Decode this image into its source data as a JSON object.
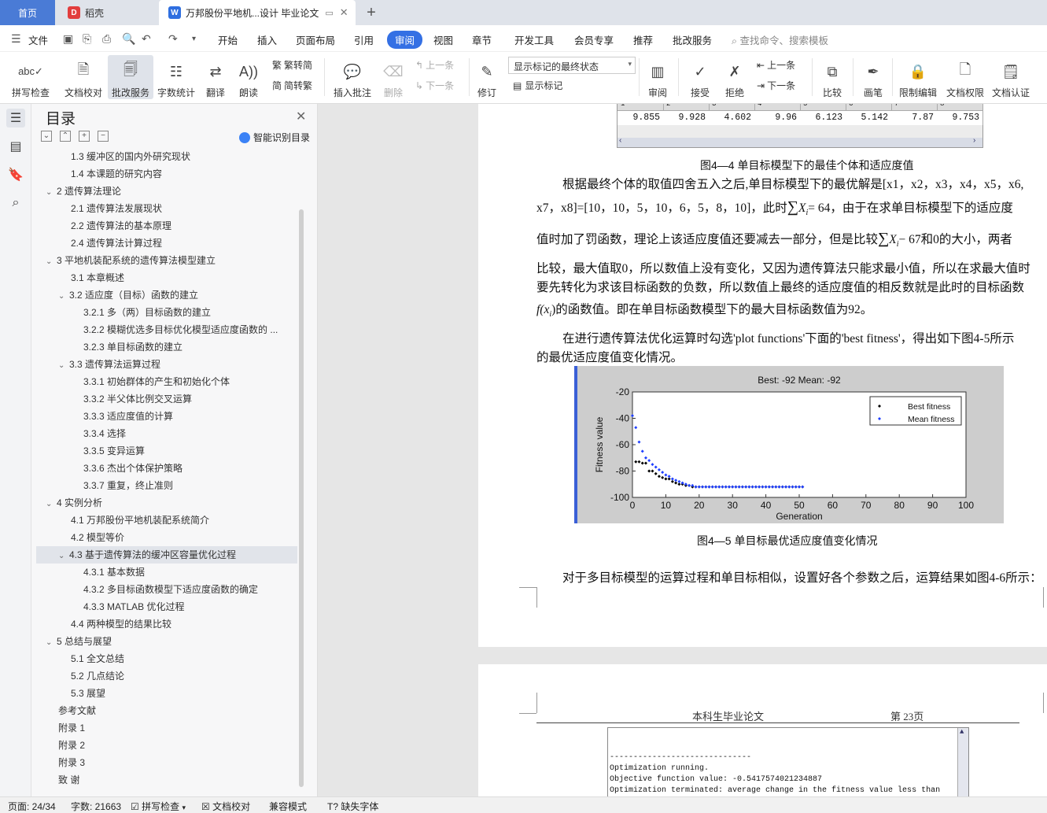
{
  "tabs": {
    "home": "首页",
    "daoke": "稻壳",
    "doc": "万邦股份平地机...设计 毕业论文",
    "plus": "+"
  },
  "menu": {
    "file": "文件",
    "items": [
      "开始",
      "插入",
      "页面布局",
      "引用",
      "审阅",
      "视图",
      "章节",
      "开发工具",
      "会员专享",
      "推荐",
      "批改服务"
    ],
    "active": "审阅",
    "search": "查找命令、搜索模板"
  },
  "ribbon": {
    "spell": "拼写检查",
    "proof": "文档校对",
    "grading": "批改服务",
    "wordcount": "字数统计",
    "translate": "翻译",
    "read": "朗读",
    "trad": "繁转简",
    "simp": "简转繁",
    "insert_comment": "插入批注",
    "delete": "删除",
    "prev": "上一条",
    "next": "下一条",
    "revise": "修订",
    "markup_state": "显示标记的最终状态",
    "show_markup": "显示标记",
    "review": "审阅",
    "accept": "接受",
    "reject": "拒绝",
    "prev2": "上一条",
    "next2": "下一条",
    "compare": "比较",
    "pen": "画笔",
    "restrict": "限制编辑",
    "perm": "文档权限",
    "cert": "文档认证"
  },
  "toc": {
    "title": "目录",
    "smart": "智能识别目录",
    "items": [
      {
        "label": "1.3  缓冲区的国内外研究现状",
        "level": 2
      },
      {
        "label": "1.4  本课题的研究内容",
        "level": 2
      },
      {
        "label": "2  遗传算法理论",
        "level": 1,
        "chev": "v"
      },
      {
        "label": "2.1  遗传算法发展现状",
        "level": 2
      },
      {
        "label": "2.2  遗传算法的基本原理",
        "level": 2
      },
      {
        "label": "2.4  遗传算法计算过程",
        "level": 2
      },
      {
        "label": "3 平地机装配系统的遗传算法模型建立",
        "level": 1,
        "chev": "v"
      },
      {
        "label": "3.1    本章概述",
        "level": 2
      },
      {
        "label": "3.2    适应度（目标）函数的建立",
        "level": 2,
        "chev": "v"
      },
      {
        "label": "3.2.1    多（两）目标函数的建立",
        "level": 3
      },
      {
        "label": "3.2.2    模糊优选多目标优化模型适应度函数的 ...",
        "level": 3
      },
      {
        "label": "3.2.3    单目标函数的建立",
        "level": 3
      },
      {
        "label": "3.3    遗传算法运算过程",
        "level": 2,
        "chev": "v"
      },
      {
        "label": "3.3.1    初始群体的产生和初始化个体",
        "level": 3
      },
      {
        "label": "3.3.2    半父体比例交叉运算",
        "level": 3
      },
      {
        "label": "3.3.3    适应度值的计算",
        "level": 3
      },
      {
        "label": "3.3.4    选择",
        "level": 3
      },
      {
        "label": "3.3.5    变异运算",
        "level": 3
      },
      {
        "label": "3.3.6    杰出个体保护策略",
        "level": 3
      },
      {
        "label": "3.3.7    重复，终止准则",
        "level": 3
      },
      {
        "label": "4  实例分析",
        "level": 1,
        "chev": "v"
      },
      {
        "label": "4.1    万邦股份平地机装配系统简介",
        "level": 2
      },
      {
        "label": "4.2    模型等价",
        "level": 2
      },
      {
        "label": "4.3    基于遗传算法的缓冲区容量优化过程",
        "level": 2,
        "chev": "v",
        "selected": true
      },
      {
        "label": "4.3.1    基本数据",
        "level": 3
      },
      {
        "label": "4.3.2    多目标函数模型下适应度函数的确定",
        "level": 3
      },
      {
        "label": "4.3.3    MATLAB 优化过程",
        "level": 3
      },
      {
        "label": "4.4    两种模型的结果比较",
        "level": 2
      },
      {
        "label": "5  总结与展望",
        "level": 1,
        "chev": "v"
      },
      {
        "label": "5.1    全文总结",
        "level": 2
      },
      {
        "label": "5.2    几点结论",
        "level": 2
      },
      {
        "label": "5.3    展望",
        "level": 2
      },
      {
        "label": "参考文献",
        "level": 0
      },
      {
        "label": "附录 1",
        "level": 0
      },
      {
        "label": "附录 2",
        "level": 0
      },
      {
        "label": "附录 3",
        "level": 0
      },
      {
        "label": "致    谢",
        "level": 0
      }
    ]
  },
  "doc": {
    "grid_header": [
      "1",
      "2",
      "3",
      "4",
      "5",
      "6",
      "7",
      "8"
    ],
    "grid_values": [
      "9.855",
      "9.928",
      "4.602",
      "9.96",
      "6.123",
      "5.142",
      "7.87",
      "9.753"
    ],
    "fig4_4": "图4—4    单目标模型下的最佳个体和适应度值",
    "p1_l1": "根据最终个体的取值四舍五入之后,单目标模型下的最优解是[x1，x2，x3，x4，x5，x6,",
    "p1_l2a": "x7，x8]=[10，10，5，10，6，5，8，10]，此时",
    "p1_l2b": "X",
    "p1_l2c": "= 64",
    "p1_l2d": "，由于在求单目标模型下的适应度",
    "p1_l3a": "值时加了罚函数，理论上该适应度值还要减去一部分，但是比较",
    "p1_l3b": "X",
    "p1_l3c": "− 67和0的大小，两者",
    "p1_l4": "比较，最大值取0，所以数值上没有变化，又因为遗传算法只能求最小值，所以在求最大值时",
    "p1_l5": "要先转化为求该目标函数的负数，所以数值上最终的适应度值的相反数就是此时的目标函数",
    "p1_l6a": "f(x",
    "p1_l6b": ")的函数值。即在单目标函数模型下的最大目标函数值为92。",
    "p2_l1": "在进行遗传算法优化运算时勾选'plot functions'下面的'best fitness'，得出如下图4-5所示",
    "p2_l2": "的最优适应度值变化情况。",
    "fig4_5": "图4—5    单目标最优适应度值变化情况",
    "p3": "对于多目标模型的运算过程和单目标相似，设置好各个参数之后，运算结果如图4-6所示：",
    "header_left": "本科生毕业论文",
    "header_right": "第 23页",
    "console": [
      "------------------------------",
      "Optimization running.",
      "Objective function value: -0.5417574021234887",
      "Optimization terminated: average change in the fitness value less than"
    ]
  },
  "chart_data": {
    "type": "scatter",
    "title": "Best: -92 Mean: -92",
    "xlabel": "Generation",
    "ylabel": "Fitness value",
    "xlim": [
      0,
      100
    ],
    "ylim": [
      -100,
      -20
    ],
    "xticks": [
      "0",
      "10",
      "20",
      "30",
      "40",
      "50",
      "60",
      "70",
      "80",
      "90",
      "100"
    ],
    "yticks": [
      "-20",
      "-40",
      "-60",
      "-80",
      "-100"
    ],
    "legend_position": "top-right",
    "series": [
      {
        "name": "Best fitness",
        "color": "#000000",
        "x": [
          1,
          2,
          3,
          4,
          5,
          6,
          7,
          8,
          9,
          10,
          11,
          12,
          13,
          14,
          15,
          16,
          17,
          18,
          19,
          20,
          21,
          22,
          23,
          24,
          25,
          26,
          27,
          28,
          29,
          30,
          31,
          32,
          33,
          34,
          35,
          36,
          37,
          38,
          39,
          40,
          41,
          42,
          43,
          44,
          45,
          46,
          47,
          48,
          49,
          50,
          51
        ],
        "y": [
          -73,
          -73,
          -74,
          -74,
          -80,
          -80,
          -82,
          -84,
          -85,
          -86,
          -86,
          -88,
          -89,
          -90,
          -90,
          -91,
          -91,
          -92,
          -92,
          -92,
          -92,
          -92,
          -92,
          -92,
          -92,
          -92,
          -92,
          -92,
          -92,
          -92,
          -92,
          -92,
          -92,
          -92,
          -92,
          -92,
          -92,
          -92,
          -92,
          -92,
          -92,
          -92,
          -92,
          -92,
          -92,
          -92,
          -92,
          -92,
          -92,
          -92,
          -92
        ]
      },
      {
        "name": "Mean fitness",
        "color": "#1f3fff",
        "x": [
          0,
          1,
          2,
          3,
          4,
          5,
          6,
          7,
          8,
          9,
          10,
          11,
          12,
          13,
          14,
          15,
          16,
          17,
          18,
          19,
          20,
          21,
          22,
          23,
          24,
          25,
          26,
          27,
          28,
          29,
          30,
          31,
          32,
          33,
          34,
          35,
          36,
          37,
          38,
          39,
          40,
          41,
          42,
          43,
          44,
          45,
          46,
          47,
          48,
          49,
          50,
          51
        ],
        "y": [
          -38,
          -47,
          -58,
          -65,
          -70,
          -72,
          -75,
          -77,
          -79,
          -81,
          -83,
          -84,
          -86,
          -87,
          -88,
          -89,
          -90,
          -91,
          -91,
          -92,
          -92,
          -92,
          -92,
          -92,
          -92,
          -92,
          -92,
          -92,
          -92,
          -92,
          -92,
          -92,
          -92,
          -92,
          -92,
          -92,
          -92,
          -92,
          -92,
          -92,
          -92,
          -92,
          -92,
          -92,
          -92,
          -92,
          -92,
          -92,
          -92,
          -92,
          -92,
          -92
        ]
      }
    ]
  },
  "status": {
    "page": "页面: 24/34",
    "words": "字数: 21663",
    "spell": "拼写检查",
    "proof": "文档校对",
    "compat": "兼容模式",
    "font": "缺失字体"
  },
  "colors": {
    "accent": "#3470e4",
    "home_tab": "#4a7bd6",
    "daoke_icon": "#e23d3d",
    "doc_icon": "#2f6fe0"
  }
}
